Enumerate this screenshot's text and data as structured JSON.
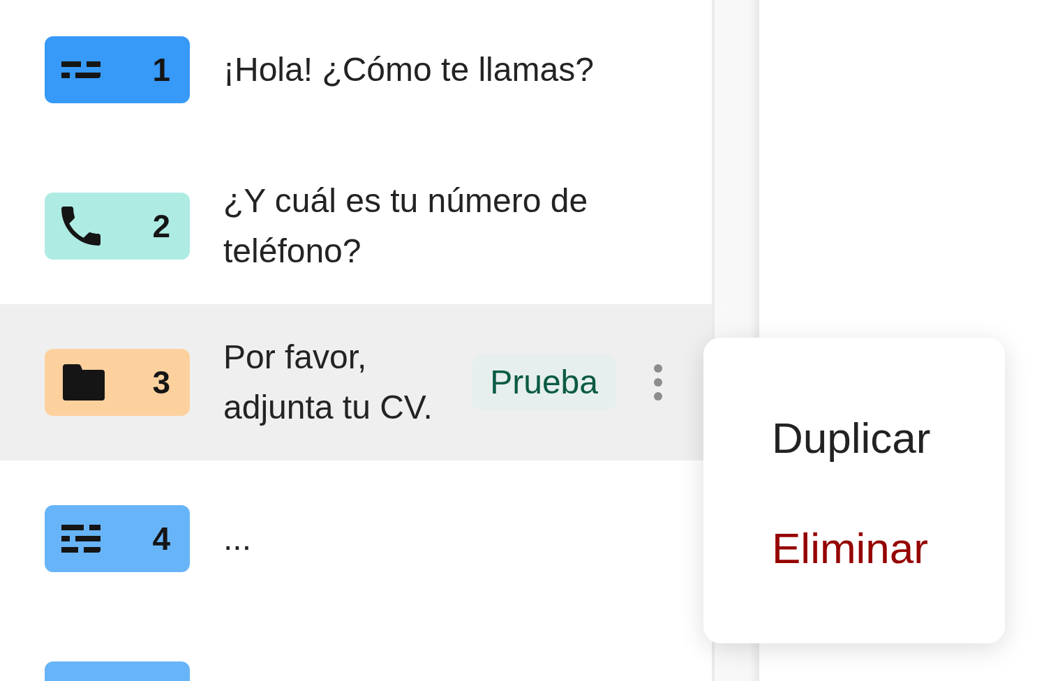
{
  "questions": [
    {
      "kind": "short_text",
      "number": "1",
      "color": "#3799f8",
      "text": "¡Hola! ¿Cómo te llamas?",
      "selected": false
    },
    {
      "kind": "phone",
      "number": "2",
      "color": "#aeebe3",
      "text": "¿Y cuál es tu número de teléfono?",
      "selected": false
    },
    {
      "kind": "file_upload",
      "number": "3",
      "color": "#fdd19e",
      "text": "Por favor, adjunta tu CV.",
      "selected": true,
      "tag": "Prueba",
      "more_button": true
    },
    {
      "kind": "long_text",
      "number": "4",
      "color": "#68b4f8",
      "text": "...",
      "selected": false
    },
    {
      "color": "#68b4f8",
      "selected": false
    }
  ],
  "context_menu": {
    "items": [
      {
        "label": "Duplicar",
        "kind": "normal"
      },
      {
        "label": "Eliminar",
        "kind": "danger"
      }
    ]
  }
}
